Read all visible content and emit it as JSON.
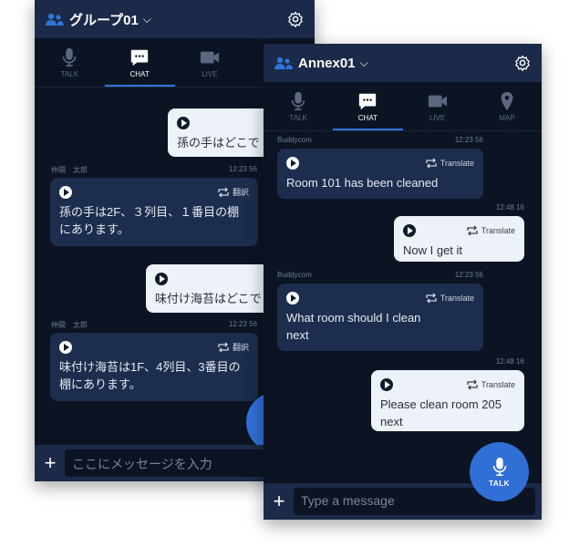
{
  "back": {
    "title": "グループ01",
    "tabs": [
      "TALK",
      "CHAT",
      "LIVE"
    ],
    "messages": [
      {
        "dir": "out",
        "text": "孫の手はどこで"
      },
      {
        "dir": "in",
        "sender": "仲間　太郎",
        "time": "12:23 56",
        "translate": "翻訳",
        "text": "孫の手は2F、３列目、１番目の棚にあります。"
      },
      {
        "dir": "out",
        "text": "味付け海苔はどこで"
      },
      {
        "dir": "in",
        "sender": "仲間　太郎",
        "time": "12:23 56",
        "translate": "翻訳",
        "text": "味付け海苔は1F、4列目、3番目の棚にあります。"
      }
    ],
    "input_placeholder": "ここにメッセージを入力"
  },
  "front": {
    "title": "Annex01",
    "tabs": [
      "TALK",
      "CHAT",
      "LIVE",
      "MAP"
    ],
    "messages": [
      {
        "dir": "in",
        "sender": "Buddycom",
        "time": "12:23 56",
        "translate": "Translate",
        "text": "Room 101 has been cleaned"
      },
      {
        "dir": "out",
        "time": "12:48 16",
        "translate": "Translate",
        "text": "Now I get it"
      },
      {
        "dir": "in",
        "sender": "Buddycom",
        "time": "12:23 56",
        "translate": "Translate",
        "text": "What room should I clean next"
      },
      {
        "dir": "out",
        "time": "12:48 16",
        "translate": "Translate",
        "text": "Please clean room 205 next"
      }
    ],
    "input_placeholder": "Type a message",
    "talk_button": "TALK"
  },
  "colors": {
    "header": "#1b2a48",
    "body": "#0c1424",
    "accent": "#2f6fd6"
  }
}
